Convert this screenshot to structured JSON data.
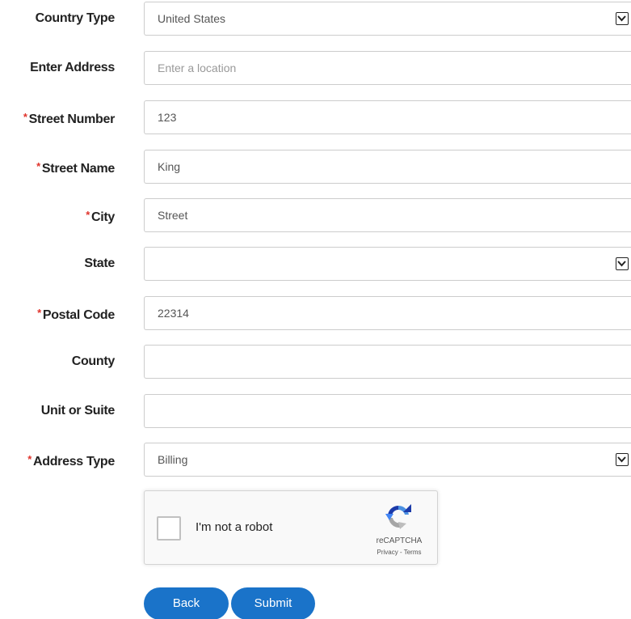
{
  "form": {
    "country_type": {
      "label": "Country Type",
      "required": false,
      "value": "United States",
      "kind": "select"
    },
    "enter_address": {
      "label": "Enter Address",
      "required": false,
      "value": "",
      "placeholder": "Enter a location",
      "kind": "text"
    },
    "street_number": {
      "label": "Street Number",
      "required": true,
      "value": "123",
      "kind": "text"
    },
    "street_name": {
      "label": "Street Name",
      "required": true,
      "value": "King",
      "kind": "text"
    },
    "city": {
      "label": "City",
      "required": true,
      "value": "Street",
      "kind": "text"
    },
    "state": {
      "label": "State",
      "required": false,
      "value": "",
      "kind": "select"
    },
    "postal_code": {
      "label": "Postal Code",
      "required": true,
      "value": "22314",
      "kind": "text"
    },
    "county": {
      "label": "County",
      "required": false,
      "value": "",
      "kind": "text"
    },
    "unit_or_suite": {
      "label": "Unit or Suite",
      "required": false,
      "value": "",
      "kind": "text"
    },
    "address_type": {
      "label": "Address Type",
      "required": true,
      "value": "Billing",
      "kind": "select"
    },
    "required_marker": "*"
  },
  "captcha": {
    "checkbox_label": "I'm not a robot",
    "brand": "reCAPTCHA",
    "links": "Privacy - Terms",
    "icon": "recaptcha-logo-icon"
  },
  "buttons": {
    "back": "Back",
    "submit": "Submit"
  },
  "colors": {
    "required_marker": "#e0332b",
    "button_bg": "#1a73c9",
    "button_text": "#ffffff",
    "field_border": "#cccccc",
    "label_text": "#222222"
  }
}
